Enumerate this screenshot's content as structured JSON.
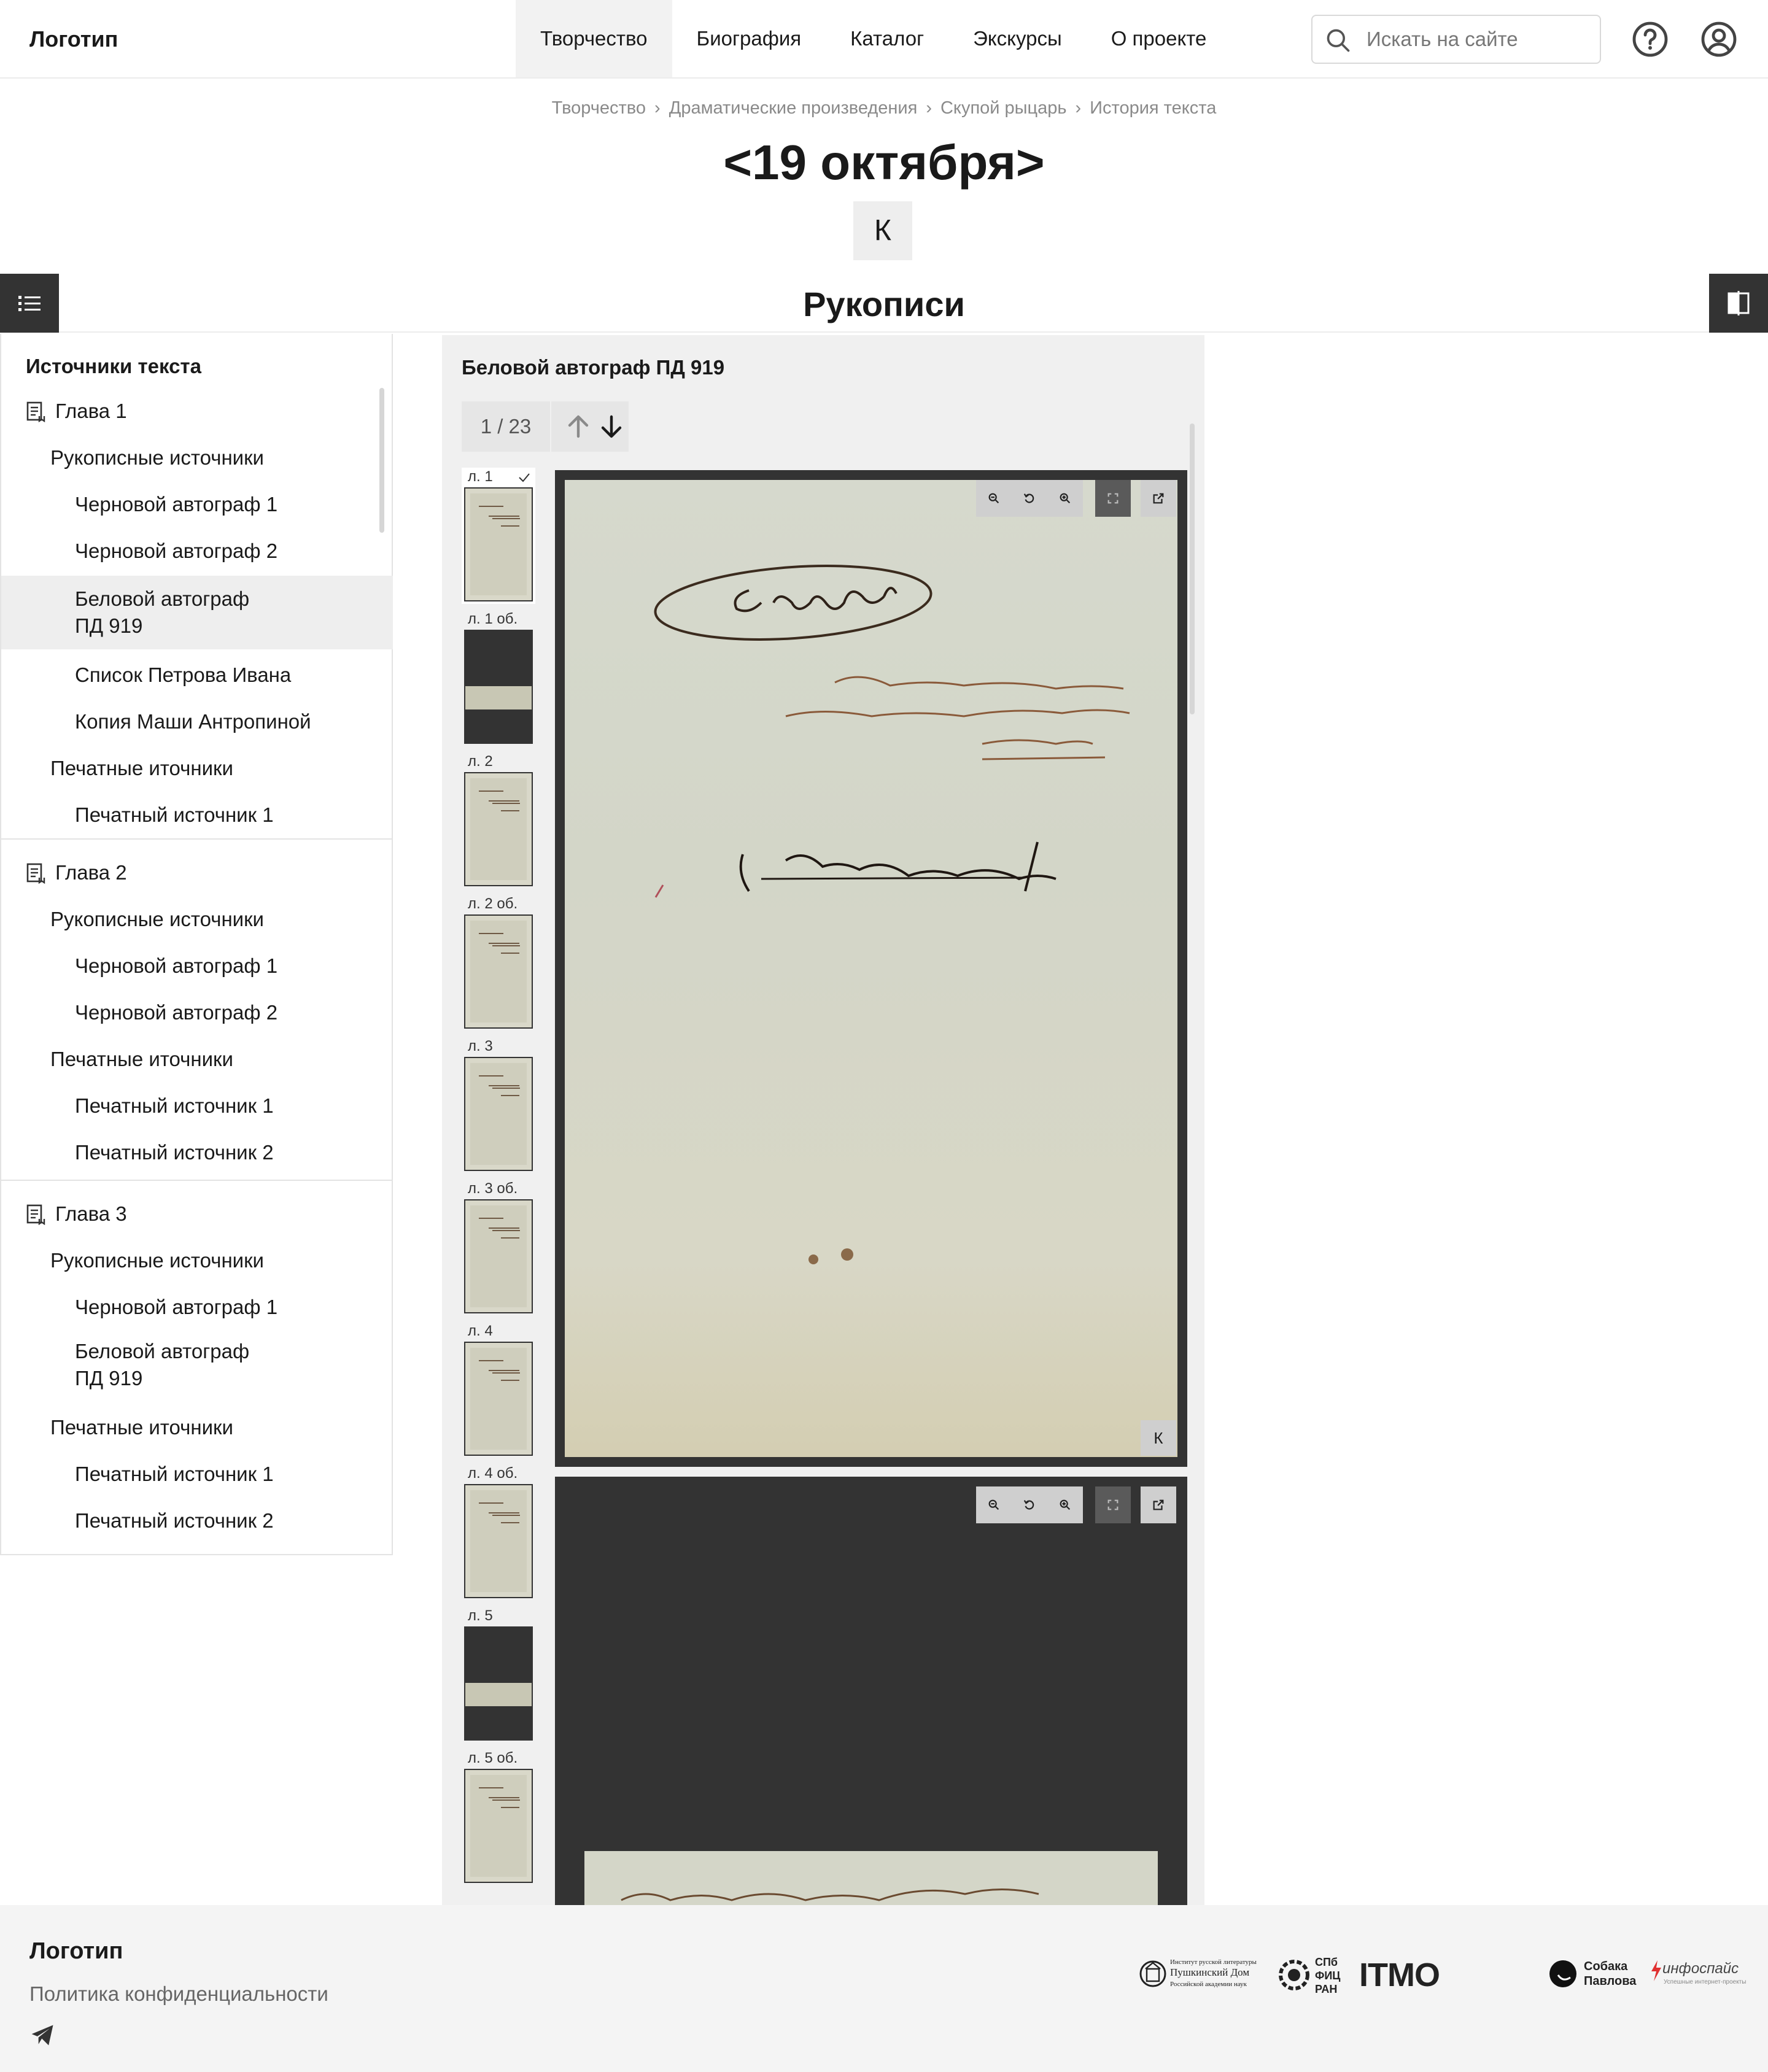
{
  "header": {
    "logo": "Логотип",
    "nav": [
      {
        "label": "Творчество",
        "active": true
      },
      {
        "label": "Биография",
        "active": false
      },
      {
        "label": "Каталог",
        "active": false
      },
      {
        "label": "Экскурсы",
        "active": false
      },
      {
        "label": "О проекте",
        "active": false
      }
    ],
    "search_placeholder": "Искать на сайте",
    "icons": [
      "search-icon",
      "help-icon",
      "account-icon"
    ]
  },
  "breadcrumb": [
    "Творчество",
    "Драматические произведения",
    "Скупой рыцарь",
    "История текста"
  ],
  "page_title": "<19 октября>",
  "k_button": "К",
  "section_title": "Рукописи",
  "sidebar": {
    "heading": "Источники текста",
    "chapters": [
      {
        "title": "Глава 1",
        "groups": [
          {
            "title": "Рукописные источники",
            "items": [
              "Черновой автограф 1",
              "Черновой автограф 2",
              "Беловой автограф ПД 919",
              "Список Петрова Ивана",
              "Копия Маши Антропиной"
            ]
          },
          {
            "title": "Печатные иточники",
            "items": [
              "Печатный источник 1"
            ]
          }
        ]
      },
      {
        "title": "Глава 2",
        "groups": [
          {
            "title": "Рукописные источники",
            "items": [
              "Черновой автограф 1",
              "Черновой автограф 2"
            ]
          },
          {
            "title": "Печатные иточники",
            "items": [
              "Печатный источник 1",
              "Печатный источник 2"
            ]
          }
        ]
      },
      {
        "title": "Глава 3",
        "groups": [
          {
            "title": "Рукописные источники",
            "items": [
              "Черновой автограф 1",
              "Беловой автограф ПД 919"
            ]
          },
          {
            "title": "Печатные иточники",
            "items": [
              "Печатный источник 1",
              "Печатный источник 2"
            ]
          }
        ]
      }
    ],
    "selected_item": "Беловой автограф ПД 919"
  },
  "viewer": {
    "title": "Беловой автограф ПД 919",
    "page_counter": "1 / 23",
    "current_page": 1,
    "total_pages": 23,
    "thumbnails": [
      "л. 1",
      "л. 1 об.",
      "л. 2",
      "л. 2 об.",
      "л. 3",
      "л. 3 об.",
      "л. 4",
      "л. 4 об.",
      "л. 5",
      "л. 5 об."
    ],
    "thumbnail_types": [
      "page",
      "dark",
      "page",
      "page",
      "page",
      "page",
      "page",
      "page",
      "dark",
      "page"
    ],
    "page_k_label": "К",
    "tools": [
      "zoom-out-icon",
      "rotate-icon",
      "zoom-in-icon",
      "fullscreen-icon",
      "open-external-icon"
    ]
  },
  "footer": {
    "logo": "Логотип",
    "privacy": "Политика конфиденциальности",
    "partners": {
      "pushkin_house": [
        "Институт русской литературы",
        "Пушкинский Дом",
        "Российской академии наук"
      ],
      "spb": [
        "СПб",
        "ФИЦ",
        "РАН"
      ],
      "itmo": "ITMO",
      "sobaka": [
        "Собака",
        "Павлова"
      ],
      "infospace": "инфоспайс",
      "infospace_tagline": "Успешные интернет-проекты"
    }
  },
  "colors": {
    "dark": "#333333",
    "panel": "#f0f0f0",
    "selected": "#eeeeee",
    "muted": "#8a8a8a"
  }
}
